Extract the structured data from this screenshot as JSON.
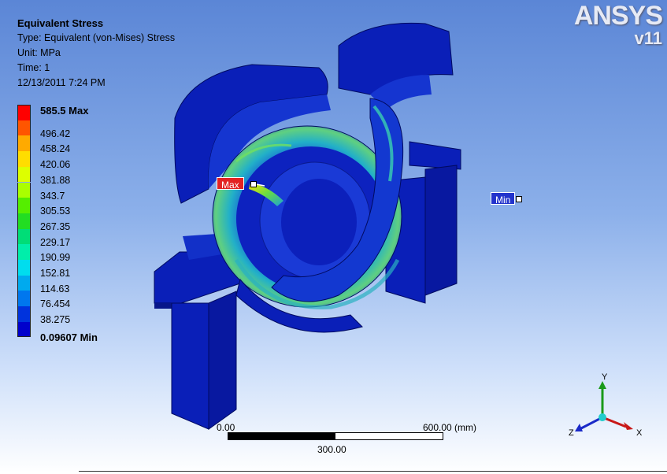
{
  "result": {
    "title": "Equivalent Stress",
    "type": "Type: Equivalent (von-Mises) Stress",
    "unit": "Unit: MPa",
    "time": "Time: 1",
    "date": "12/13/2011 7:24 PM"
  },
  "legend": {
    "entries": [
      {
        "label": "585.5 Max",
        "color": "#ff0000"
      },
      {
        "label": "496.42",
        "color": "#ff5500"
      },
      {
        "label": "458.24",
        "color": "#ffaa00"
      },
      {
        "label": "420.06",
        "color": "#ffdd00"
      },
      {
        "label": "381.88",
        "color": "#ddff00"
      },
      {
        "label": "343.7",
        "color": "#aaff00"
      },
      {
        "label": "305.53",
        "color": "#55ee00"
      },
      {
        "label": "267.35",
        "color": "#22dd22"
      },
      {
        "label": "229.17",
        "color": "#00dd77"
      },
      {
        "label": "190.99",
        "color": "#00eeaa"
      },
      {
        "label": "152.81",
        "color": "#00ddee"
      },
      {
        "label": "114.63",
        "color": "#00aaee"
      },
      {
        "label": "76.454",
        "color": "#0077ee"
      },
      {
        "label": "38.275",
        "color": "#0033dd"
      },
      {
        "label": "0.09607 Min",
        "color": "#0000cc"
      }
    ]
  },
  "logo": {
    "brand": "ANSYS",
    "version": "v11"
  },
  "probes": {
    "max": "Max",
    "min": "Min"
  },
  "scale_bar": {
    "start": "0.00",
    "end": "600.00 (mm)",
    "mid": "300.00"
  },
  "triad": {
    "x": "X",
    "y": "Y",
    "z": "Z"
  },
  "colors": {
    "background_top": "#5b86d6",
    "background_bottom": "#ffffff",
    "model_blue": "#0a1fb8"
  }
}
